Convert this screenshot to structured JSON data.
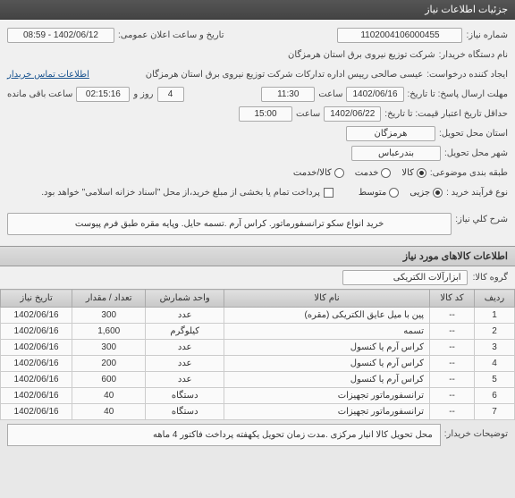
{
  "header": {
    "title": "جزئیات اطلاعات نیاز"
  },
  "fields": {
    "need_no_label": "شماره نیاز:",
    "need_no": "1102004106000455",
    "pub_date_label": "تاریخ و ساعت اعلان عمومی:",
    "pub_date": "1402/06/12 - 08:59",
    "buyer_label": "نام دستگاه خریدار:",
    "buyer": "شرکت توزیع نیروی برق استان هرمزگان",
    "requester_label": "ایجاد کننده درخواست:",
    "requester": "عیسی صالحی  رییس اداره تدارکات شرکت توزیع نیروی برق استان هرمزگان",
    "contact_link": "اطلاعات تماس خریدار",
    "deadline_label": "مهلت ارسال پاسخ: تا تاریخ:",
    "deadline_date": "1402/06/16",
    "time_label": "ساعت",
    "deadline_time": "11:30",
    "days_label": "روز و",
    "days": "4",
    "remain_time": "02:15:16",
    "remain_label": "ساعت باقی مانده",
    "validity_label": "حداقل تاریخ اعتبار قیمت: تا تاریخ:",
    "validity_date": "1402/06/22",
    "validity_time": "15:00",
    "province_label": "استان محل تحویل:",
    "province": "هرمزگان",
    "city_label": "شهر محل تحویل:",
    "city": "بندرعباس",
    "category_label": "طبقه بندی موضوعی:",
    "cat_kala": "کالا",
    "cat_khadamat": "خدمت",
    "cat_both": "کالا/خدمت",
    "process_label": "نوع فرآیند خرید :",
    "proc_partial": "جزیی",
    "proc_medium": "متوسط",
    "payment_note": "پرداخت تمام یا بخشی از مبلغ خرید،از محل \"اسناد خزانه اسلامی\" خواهد بود.",
    "desc_label": "شرح کلي نیاز:",
    "desc": "خرید انواع سکو ترانسفورماتور. کراس آرم .تسمه حایل. وپایه مقره طبق فرم پیوست",
    "items_section": "اطلاعات کالاهای مورد نیاز",
    "group_label": "گروه کالا:",
    "group": "ابزارآلات الکتریکی",
    "buyer_note_label": "توضیحات خریدار:",
    "buyer_note": "محل تحویل کالا انبار مرکزی .مدت زمان تحویل یکهفته پرداخت فاکتور 4 ماهه"
  },
  "table": {
    "headers": {
      "row": "ردیف",
      "code": "کد کالا",
      "name": "نام کالا",
      "unit": "واحد شمارش",
      "qty": "تعداد / مقدار",
      "date": "تاریخ نیاز"
    },
    "rows": [
      {
        "n": "1",
        "code": "--",
        "name": "پین با میل عایق الکتریکی (مقره)",
        "unit": "عدد",
        "qty": "300",
        "date": "1402/06/16"
      },
      {
        "n": "2",
        "code": "--",
        "name": "تسمه",
        "unit": "کیلوگرم",
        "qty": "1,600",
        "date": "1402/06/16"
      },
      {
        "n": "3",
        "code": "--",
        "name": "کراس آرم یا کنسول",
        "unit": "عدد",
        "qty": "300",
        "date": "1402/06/16"
      },
      {
        "n": "4",
        "code": "--",
        "name": "کراس آرم یا کنسول",
        "unit": "عدد",
        "qty": "200",
        "date": "1402/06/16"
      },
      {
        "n": "5",
        "code": "--",
        "name": "کراس آرم یا کنسول",
        "unit": "عدد",
        "qty": "600",
        "date": "1402/06/16"
      },
      {
        "n": "6",
        "code": "--",
        "name": "ترانسفورماتور تجهیزات",
        "unit": "دستگاه",
        "qty": "40",
        "date": "1402/06/16"
      },
      {
        "n": "7",
        "code": "--",
        "name": "ترانسفورماتور تجهیزات",
        "unit": "دستگاه",
        "qty": "40",
        "date": "1402/06/16"
      }
    ]
  }
}
